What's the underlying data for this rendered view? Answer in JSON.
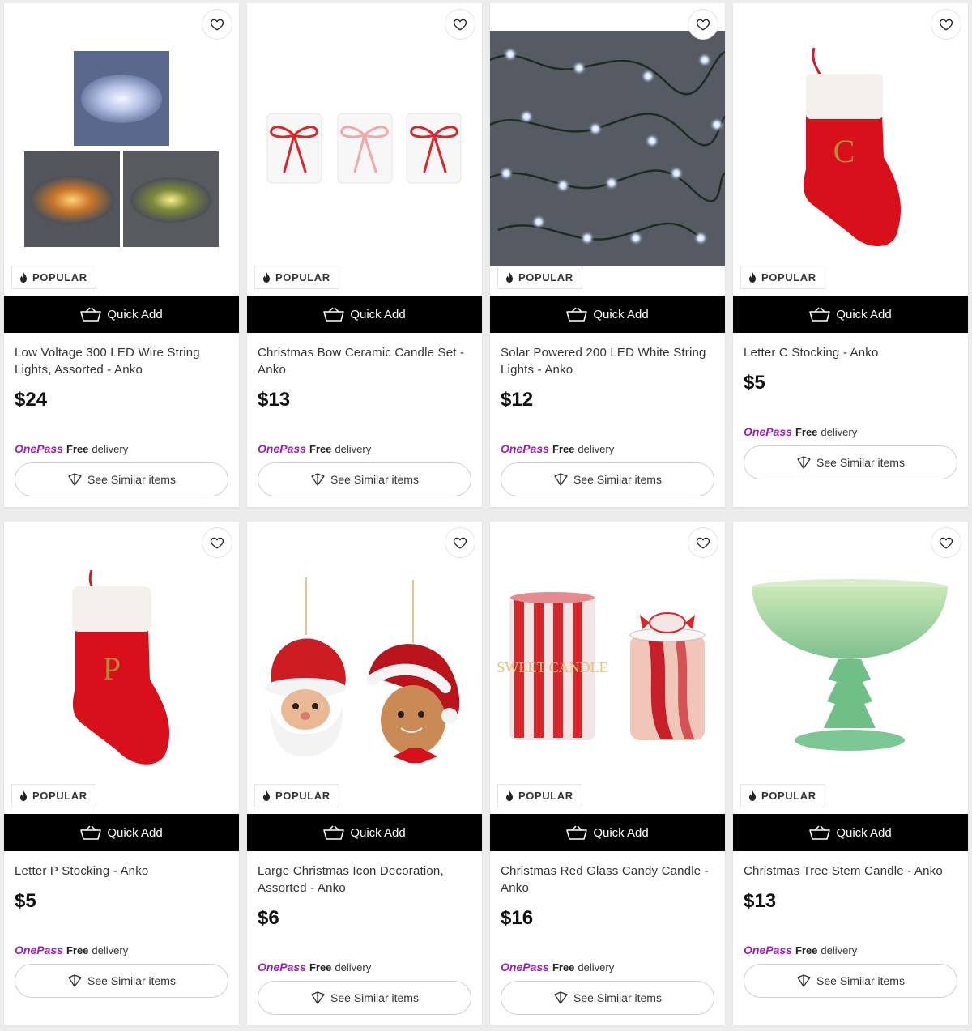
{
  "common": {
    "badge_label": "POPULAR",
    "quick_add_label": "Quick Add",
    "onepass_logo": "OnePass",
    "free_label": "Free",
    "delivery_label": "delivery",
    "see_similar_label": "See Similar items"
  },
  "colors": {
    "onepass_purple": "#9c1bb7",
    "quick_add_bg": "#000000"
  },
  "products": [
    {
      "title": "Low Voltage 300 LED Wire String Lights, Assorted - Anko",
      "price": "$24",
      "image": "wire-string-lights-photo"
    },
    {
      "title": "Christmas Bow Ceramic Candle Set - Anko",
      "price": "$13",
      "image": "bow-candle-set-photo"
    },
    {
      "title": "Solar Powered 200 LED White String Lights - Anko",
      "price": "$12",
      "image": "solar-string-lights-photo"
    },
    {
      "title": "Letter C Stocking - Anko",
      "price": "$5",
      "image": "letter-c-stocking-photo",
      "monogram": "C"
    },
    {
      "title": "Letter P Stocking - Anko",
      "price": "$5",
      "image": "letter-p-stocking-photo",
      "monogram": "P"
    },
    {
      "title": "Large Christmas Icon Decoration, Assorted - Anko",
      "price": "$6",
      "image": "christmas-icon-ornaments-photo"
    },
    {
      "title": "Christmas Red Glass Candy Candle - Anko",
      "price": "$16",
      "image": "candy-candle-photo",
      "box_text": "SWEET CANDLE"
    },
    {
      "title": "Christmas Tree Stem Candle - Anko",
      "price": "$13",
      "image": "tree-stem-candle-photo"
    }
  ]
}
